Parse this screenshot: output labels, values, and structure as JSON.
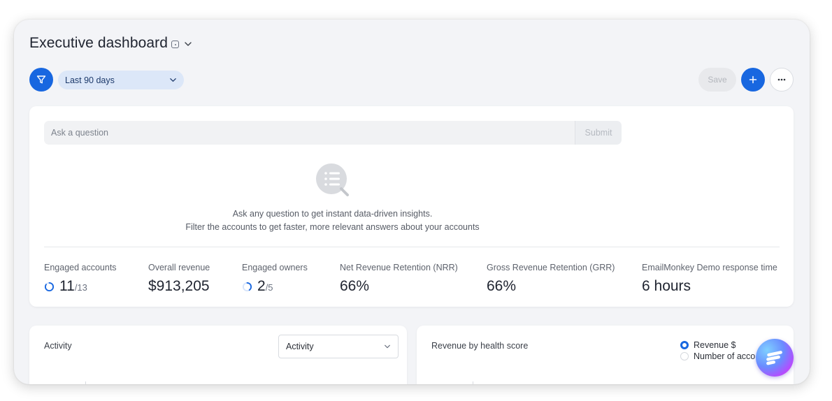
{
  "header": {
    "title": "Executive dashboard"
  },
  "toolbar": {
    "date_range": "Last 90 days",
    "save_label": "Save"
  },
  "insights": {
    "input_placeholder": "Ask a question",
    "submit_label": "Submit",
    "empty_line1": "Ask any question to get instant data-driven insights.",
    "empty_line2": "Filter the accounts to get faster, more relevant answers about your accounts"
  },
  "metrics": [
    {
      "label": "Engaged accounts",
      "value": "11",
      "denominator": "/13"
    },
    {
      "label": "Overall revenue",
      "value": "$913,205"
    },
    {
      "label": "Engaged owners",
      "value": "2",
      "denominator": "/5"
    },
    {
      "label": "Net Revenue Retention (NRR)",
      "value": "66%"
    },
    {
      "label": "Gross Revenue Retention (GRR)",
      "value": "66%"
    },
    {
      "label": "EmailMonkey Demo response time",
      "value": "6 hours"
    }
  ],
  "activity_card": {
    "title": "Activity",
    "select_value": "Activity"
  },
  "health_card": {
    "title": "Revenue by health score",
    "options": [
      {
        "label": "Revenue $",
        "selected": true
      },
      {
        "label": "Number of acco",
        "selected": false
      }
    ]
  },
  "colors": {
    "accent": "#1867e0",
    "range_bg": "#dce7f8",
    "text_primary": "#1f2430"
  }
}
